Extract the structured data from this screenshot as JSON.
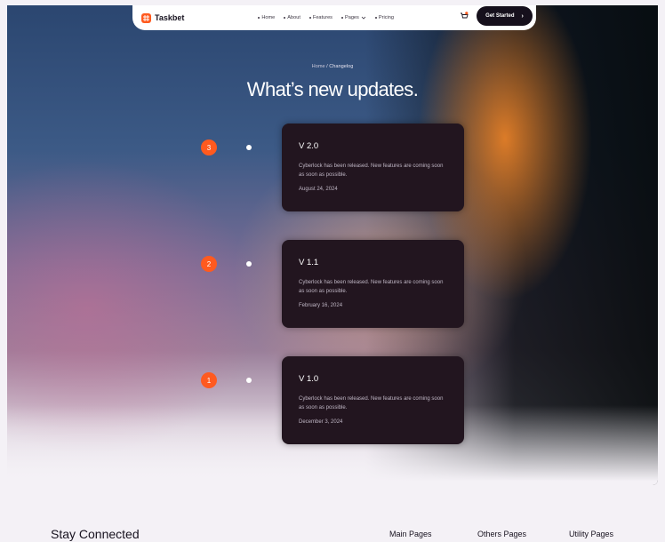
{
  "brand": {
    "name": "Taskbet",
    "accent": "#ff5a1f"
  },
  "nav": {
    "items": [
      {
        "label": "Home"
      },
      {
        "label": "About"
      },
      {
        "label": "Features"
      },
      {
        "label": "Pages"
      },
      {
        "label": "Pricing"
      }
    ],
    "cart_icon": "cart-icon",
    "cta_label": "Get Started"
  },
  "breadcrumb": {
    "home": "Home",
    "separator": " / ",
    "current": "Changelog"
  },
  "hero": {
    "title": "What’s new updates."
  },
  "changelog": [
    {
      "index": "3",
      "version": "V 2.0",
      "description": "Cyberlock has been released. New features are coming soon as soon as possible.",
      "date": "August 24, 2024"
    },
    {
      "index": "2",
      "version": "V 1.1",
      "description": "Cyberlock has been released. New features are coming soon as soon as possible.",
      "date": "February 16, 2024"
    },
    {
      "index": "1",
      "version": "V 1.0",
      "description": "Cyberlock has been released. New features are coming soon as soon as possible.",
      "date": "December 3, 2024"
    }
  ],
  "footer": {
    "title": "Stay Connected",
    "columns": [
      "Main Pages",
      "Others Pages",
      "Utility Pages"
    ]
  }
}
